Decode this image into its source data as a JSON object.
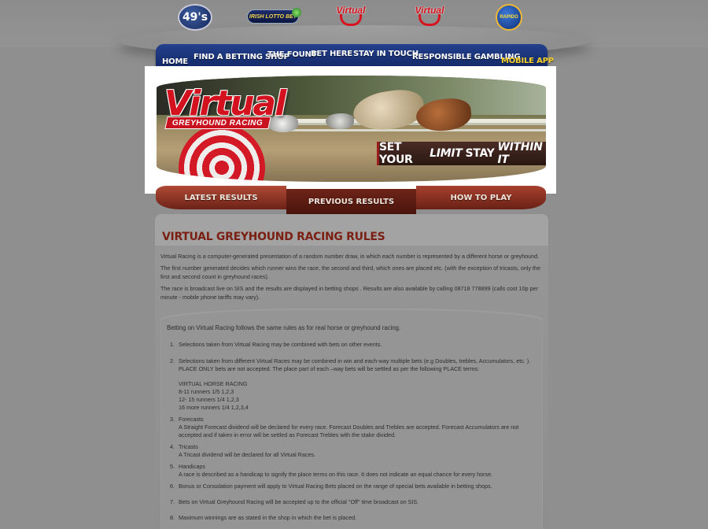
{
  "logos": {
    "lotto49": "49's",
    "irish_lotto": "IRISH LOTTO BET",
    "virtual_horse": "Virtual",
    "virtual_greyhound": "Virtual",
    "rapido": "RAPIDO"
  },
  "nav": {
    "items": [
      {
        "label": "HOME"
      },
      {
        "label": "FIND A BETTING SHOP"
      },
      {
        "label": "THE FOUNT"
      },
      {
        "label": "BET HERE"
      },
      {
        "label": "STAY IN TOUCH"
      },
      {
        "label": "RESPONSIBLE GAMBLING"
      },
      {
        "label": "MOBILE APP"
      }
    ]
  },
  "banner": {
    "brand": "Virtual",
    "sub": "GREYHOUND RACING",
    "slogan_pre": "SET YOUR",
    "slogan_em": "LIMIT",
    "slogan_post": "STAY",
    "slogan_end": "WITHIN IT"
  },
  "tabs": {
    "latest": "LATEST RESULTS",
    "previous": "PREVIOUS RESULTS",
    "how": "HOW TO PLAY"
  },
  "content": {
    "title": "VIRTUAL GREYHOUND RACING RULES",
    "para1": "Virtual Racing is a computer-generated presentation of a random number draw, in which each number is represented by a different horse or greyhound.",
    "para2": "The first number generated decides which runner wins the race, the second and third, which ones are placed etc. (with the exception of tricasts, only the first and second count in greyhound races).",
    "para3": "The race is broadcast live on SIS and the results are displayed in betting shops . Results are also available by calling 08718 778899 (calls cost 10p per minute - mobile phone tariffs may vary).",
    "rules_intro": "Betting on Virtual Racing follows the same rules as for real horse or greyhound racing.",
    "rules": [
      {
        "num": "1.",
        "text": "Selections taken from Virtual Racing may be combined with bets on other events."
      },
      {
        "num": "2.",
        "text": "Selections taken from different Virtual Races may be combined in win and each-way multiple bets (e.g Doubles, trebles, Accumulators, etc. ). PLACE ONLY bets are not accepted. The place part of each –way bets will be settled as per the following PLACE terms:"
      },
      {
        "num": "",
        "text": "VIRTUAL HORSE RACING"
      },
      {
        "num": "",
        "text": "8-11 runners 1/5 1,2,3"
      },
      {
        "num": "",
        "text": "12- 15 runners 1/4 1,2,3"
      },
      {
        "num": "",
        "text": "16 more runners 1/4 1,2,3,4"
      },
      {
        "num": "3.",
        "text": "Forecasts"
      },
      {
        "num": "",
        "text": "A Straight Forecast dividend will be declared for every race. Forecast Doubles and Trebles are accepted. Forecast Accumulators are not accepted and if taken in error will be settled as Forecast Trebles with the stake divided."
      },
      {
        "num": "4.",
        "text": "Tricasts"
      },
      {
        "num": "",
        "text": "A Tricast dividend will be declared for all Virtual Races."
      },
      {
        "num": "5.",
        "text": "Handicaps"
      },
      {
        "num": "",
        "text": "A race is described as a handicap to signify the place terms on this race. It does not indicate an equal chance for every horse."
      },
      {
        "num": "6.",
        "text": "Bonus or Consolation payment will apply to Virtual Racing Bets placed on the range of special bets available in betting shops."
      },
      {
        "num": "7.",
        "text": "Bets on Virtual Greyhound Racing will be accepted up to the official \"Off\" time broadcast on SIS."
      },
      {
        "num": "8.",
        "text": "Maximum winnings are as stated in the shop in which the bet is placed."
      }
    ]
  }
}
